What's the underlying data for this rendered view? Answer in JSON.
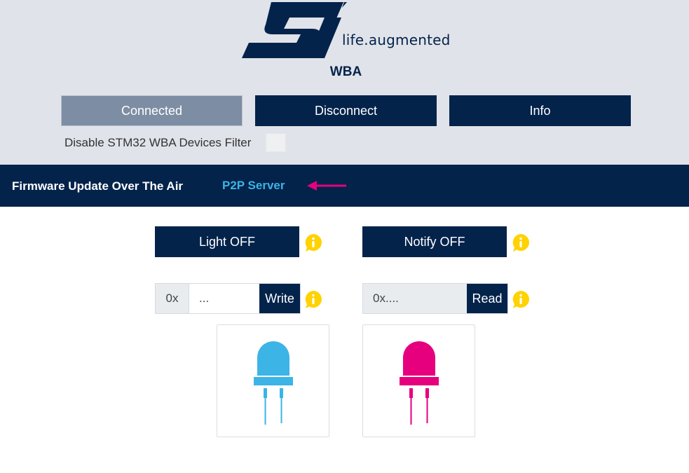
{
  "brand": {
    "tagline": "life.augmented",
    "logo_color": "#03234b"
  },
  "device": {
    "title": "WBA"
  },
  "toolbar": {
    "connected_label": "Connected",
    "disconnect_label": "Disconnect",
    "info_label": "Info"
  },
  "filter": {
    "label": "Disable STM32 WBA Devices Filter",
    "checked": false
  },
  "nav": {
    "tabs": [
      {
        "label": "Firmware Update Over The Air",
        "active": false
      },
      {
        "label": "P2P Server",
        "active": true
      }
    ],
    "arrow_color": "#e6007e"
  },
  "p2p": {
    "light_button_label": "Light OFF",
    "notify_button_label": "Notify OFF",
    "write": {
      "prefix": "0x",
      "value": "...",
      "button_label": "Write"
    },
    "read": {
      "value": "0x....",
      "button_label": "Read"
    },
    "leds": [
      {
        "name": "blue-led",
        "color": "#3cb4e6"
      },
      {
        "name": "pink-led",
        "color": "#e6007e"
      }
    ],
    "info_icon_color": "#ffd200"
  },
  "colors": {
    "primary": "#03234b",
    "accent_blue": "#3cb4e6",
    "accent_pink": "#e6007e",
    "header_bg": "#e0e3e9"
  }
}
